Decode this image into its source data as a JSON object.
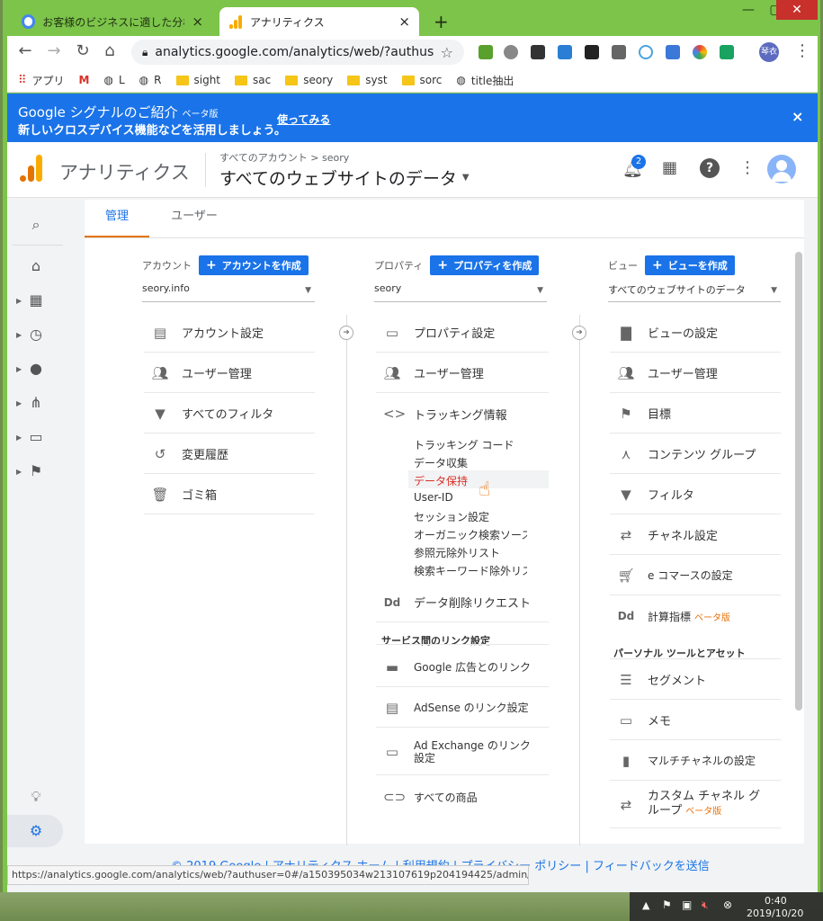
{
  "tabs": [
    {
      "title": "お客様のビジネスに適した分析ツール"
    },
    {
      "title": "アナリティクス"
    }
  ],
  "toolbar": {
    "url": "analytics.google.com/analytics/web/?authus…"
  },
  "bookmarks": [
    {
      "label": "アプリ"
    },
    {
      "label": "L"
    },
    {
      "label": "R"
    },
    {
      "label": "sight"
    },
    {
      "label": "sac"
    },
    {
      "label": "seory"
    },
    {
      "label": "syst"
    },
    {
      "label": "sorc"
    },
    {
      "label": "title抽出"
    }
  ],
  "profile_initial": "琴衣",
  "banner": {
    "title": "Google シグナルのご紹介",
    "beta": "ベータ版",
    "subtitle": "新しいクロスデバイス機能などを活用しましょう。",
    "cta": "使ってみる",
    "close": "×"
  },
  "header": {
    "app_name": "アナリティクス",
    "breadcrumb": "すべてのアカウント > seory",
    "view_name": "すべてのウェブサイトのデータ",
    "notification_count": "2"
  },
  "admin_tabs": [
    {
      "label": "管理"
    },
    {
      "label": "ユーザー"
    }
  ],
  "account": {
    "heading": "アカウント",
    "create": "アカウントを作成",
    "selected": "seory.info",
    "items": [
      "アカウント設定",
      "ユーザー管理",
      "すべてのフィルタ",
      "変更履歴",
      "ゴミ箱"
    ]
  },
  "property": {
    "heading": "プロパティ",
    "create": "プロパティを作成",
    "selected": "seory",
    "items": [
      "プロパティ設定",
      "ユーザー管理",
      "トラッキング情報"
    ],
    "tracking_sub": [
      "トラッキング コード",
      "データ収集",
      "データ保持",
      "User-ID",
      "セッション設定",
      "オーガニック検索ソース",
      "参照元除外リスト",
      "検索キーワード除外リスト"
    ],
    "delete_request": "データ削除リクエスト",
    "links_heading": "サービス間のリンク設定",
    "links": [
      "Google 広告とのリンク",
      "AdSense のリンク設定",
      "Ad Exchange のリンク設定",
      "すべての商品"
    ]
  },
  "view": {
    "heading": "ビュー",
    "create": "ビューを作成",
    "selected": "すべてのウェブサイトのデータ",
    "items": [
      "ビューの設定",
      "ユーザー管理",
      "目標",
      "コンテンツ グループ",
      "フィルタ",
      "チャネル設定",
      "e コマースの設定",
      "計算指標"
    ],
    "calc_beta": "ベータ版",
    "personal_heading": "パーソナル ツールとアセット",
    "personal": [
      "セグメント",
      "メモ",
      "マルチチャネルの設定",
      "カスタム チャネル グループ"
    ],
    "custom_beta": "ベータ版"
  },
  "footer": "© 2019 Google | アナリティクス ホーム | 利用規約 | プライバシー ポリシー | フィードバックを送信",
  "status_url": "https://analytics.google.com/analytics/web/?authuser=0#/a150395034w213107619p204194425/admin/trackinginfo/dataretention",
  "tray": {
    "time": "0:40",
    "date": "2019/10/20"
  },
  "colors": {
    "chrome_frame": "#7cc44a",
    "banner": "#1a73e8",
    "link_red": "#d93025",
    "beta_orange": "#e8710a"
  }
}
